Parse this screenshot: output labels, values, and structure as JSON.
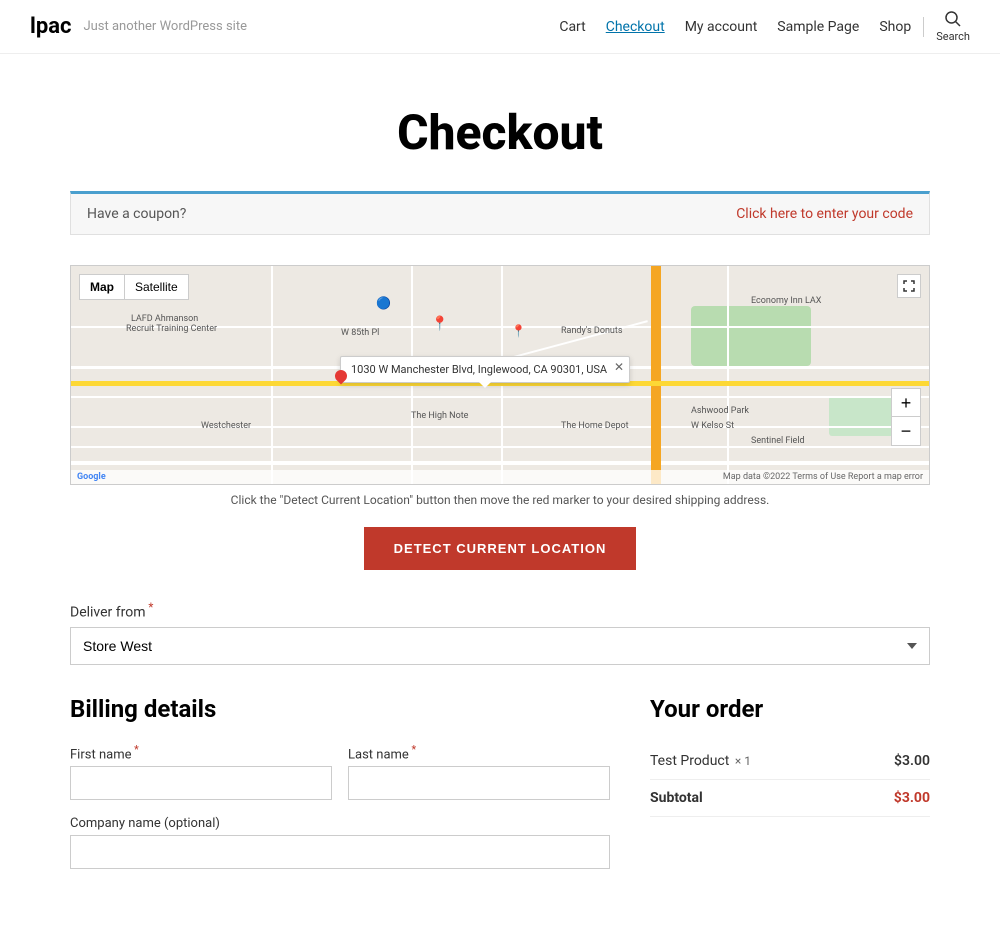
{
  "header": {
    "logo": "lpac",
    "tagline": "Just another WordPress site",
    "nav": [
      {
        "label": "Cart",
        "active": false
      },
      {
        "label": "Checkout",
        "active": true
      },
      {
        "label": "My account",
        "active": false
      },
      {
        "label": "Sample Page",
        "active": false
      },
      {
        "label": "Shop",
        "active": false
      }
    ],
    "search_label": "Search"
  },
  "page": {
    "title": "Checkout"
  },
  "coupon": {
    "text": "Have a coupon?",
    "link": "Click here to enter your code"
  },
  "map": {
    "tab_map": "Map",
    "tab_satellite": "Satellite",
    "tooltip_address": "1030 W Manchester Blvd, Inglewood, CA 90301, USA",
    "instruction": "Click the \"Detect Current Location\" button then move the red marker to your desired shipping address.",
    "attribution": "Map data ©2022 Terms of Use Report a map error",
    "zoom_in": "+",
    "zoom_out": "−"
  },
  "detect_button": {
    "label": "DETECT CURRENT LOCATION"
  },
  "deliver_from": {
    "label": "Deliver from",
    "required": true,
    "options": [
      "Store West"
    ],
    "selected": "Store West"
  },
  "billing": {
    "heading": "Billing details",
    "first_name_label": "First name",
    "last_name_label": "Last name",
    "company_label": "Company name (optional)"
  },
  "order": {
    "heading": "Your order",
    "product_name": "Test Product",
    "product_qty": "× 1",
    "product_price": "$3.00",
    "subtotal_label": "Subtotal",
    "subtotal_value": "$3.00"
  }
}
